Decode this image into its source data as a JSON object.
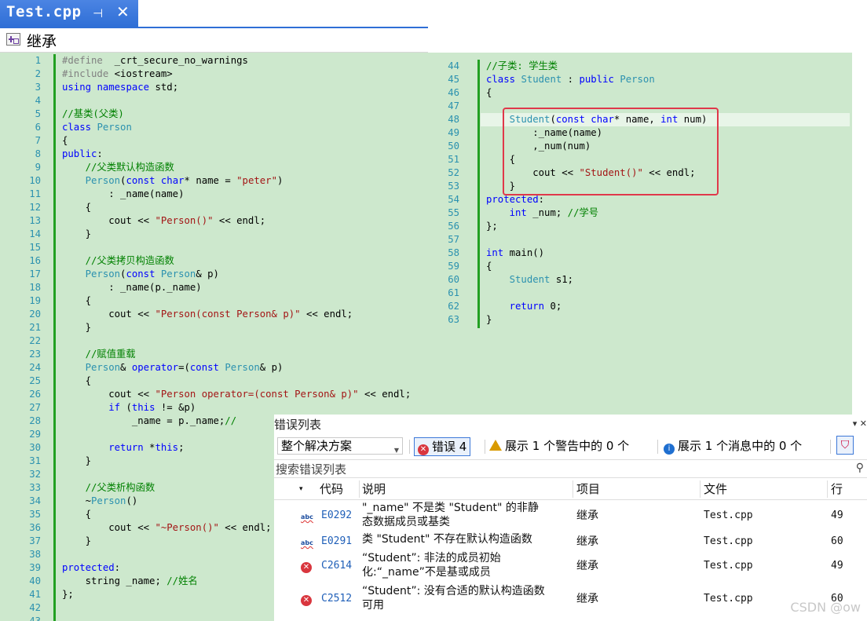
{
  "tab": {
    "title": "Test.cpp",
    "pin": "⊣",
    "close": "✕"
  },
  "nav": {
    "label": "继承"
  },
  "left_code": [
    {
      "n": "1",
      "t": "#define  _crt_secure_no_warnings"
    },
    {
      "n": "2",
      "t": "#include <iostream>"
    },
    {
      "n": "3",
      "t": "using namespace std;"
    },
    {
      "n": "4",
      "t": ""
    },
    {
      "n": "5",
      "t": "//基类(父类)"
    },
    {
      "n": "6",
      "t": "class Person"
    },
    {
      "n": "7",
      "t": "{"
    },
    {
      "n": "8",
      "t": "public:"
    },
    {
      "n": "9",
      "t": "    //父类默认构造函数"
    },
    {
      "n": "10",
      "t": "    Person(const char* name = \"peter\")"
    },
    {
      "n": "11",
      "t": "        : _name(name)"
    },
    {
      "n": "12",
      "t": "    {"
    },
    {
      "n": "13",
      "t": "        cout << \"Person()\" << endl;"
    },
    {
      "n": "14",
      "t": "    }"
    },
    {
      "n": "15",
      "t": ""
    },
    {
      "n": "16",
      "t": "    //父类拷贝构造函数"
    },
    {
      "n": "17",
      "t": "    Person(const Person& p)"
    },
    {
      "n": "18",
      "t": "        : _name(p._name)"
    },
    {
      "n": "19",
      "t": "    {"
    },
    {
      "n": "20",
      "t": "        cout << \"Person(const Person& p)\" << endl;"
    },
    {
      "n": "21",
      "t": "    }"
    },
    {
      "n": "22",
      "t": ""
    },
    {
      "n": "23",
      "t": "    //赋值重载"
    },
    {
      "n": "24",
      "t": "    Person& operator=(const Person& p)"
    },
    {
      "n": "25",
      "t": "    {"
    },
    {
      "n": "26",
      "t": "        cout << \"Person operator=(const Person& p)\" << endl;"
    },
    {
      "n": "27",
      "t": "        if (this != &p)"
    },
    {
      "n": "28",
      "t": "            _name = p._name;//"
    },
    {
      "n": "29",
      "t": ""
    },
    {
      "n": "30",
      "t": "        return *this;"
    },
    {
      "n": "31",
      "t": "    }"
    },
    {
      "n": "32",
      "t": ""
    },
    {
      "n": "33",
      "t": "    //父类析构函数"
    },
    {
      "n": "34",
      "t": "    ~Person()"
    },
    {
      "n": "35",
      "t": "    {"
    },
    {
      "n": "36",
      "t": "        cout << \"~Person()\" << endl;"
    },
    {
      "n": "37",
      "t": "    }"
    },
    {
      "n": "38",
      "t": ""
    },
    {
      "n": "39",
      "t": "protected:"
    },
    {
      "n": "40",
      "t": "    string _name; //姓名"
    },
    {
      "n": "41",
      "t": "};"
    },
    {
      "n": "42",
      "t": ""
    },
    {
      "n": "43",
      "t": ""
    }
  ],
  "right_code": [
    {
      "n": "44",
      "t": "//子类: 学生类"
    },
    {
      "n": "45",
      "t": "class Student : public Person"
    },
    {
      "n": "46",
      "t": "{"
    },
    {
      "n": "47",
      "t": ""
    },
    {
      "n": "48",
      "t": "    Student(const char* name, int num)"
    },
    {
      "n": "49",
      "t": "        :_name(name)"
    },
    {
      "n": "50",
      "t": "        ,_num(num)"
    },
    {
      "n": "51",
      "t": "    {"
    },
    {
      "n": "52",
      "t": "        cout << \"Student()\" << endl;"
    },
    {
      "n": "53",
      "t": "    }"
    },
    {
      "n": "54",
      "t": "protected:"
    },
    {
      "n": "55",
      "t": "    int _num; //学号"
    },
    {
      "n": "56",
      "t": "};"
    },
    {
      "n": "57",
      "t": ""
    },
    {
      "n": "58",
      "t": "int main()"
    },
    {
      "n": "59",
      "t": "{"
    },
    {
      "n": "60",
      "t": "    Student s1;"
    },
    {
      "n": "61",
      "t": ""
    },
    {
      "n": "62",
      "t": "    return 0;"
    },
    {
      "n": "63",
      "t": "}"
    }
  ],
  "error_list": {
    "title": "错误列表",
    "title_icons": "▾ ✕",
    "scope": "整个解决方案",
    "errors_btn": "错误 4",
    "warnings_btn": "展示 1 个警告中的 0 个",
    "messages_btn": "展示 1 个消息中的 0 个",
    "search_placeholder": "搜索错误列表",
    "headers": {
      "code": "代码",
      "desc": "说明",
      "project": "项目",
      "file": "文件",
      "line": "行"
    },
    "rows": [
      {
        "icon": "abc",
        "code": "E0292",
        "desc1": "\"_name\" 不是类 \"Student\" 的非静",
        "desc2": "态数据成员或基类",
        "project": "继承",
        "file": "Test.cpp",
        "line": "49"
      },
      {
        "icon": "abc",
        "code": "E0291",
        "desc1": "类 \"Student\" 不存在默认构造函数",
        "desc2": "",
        "project": "继承",
        "file": "Test.cpp",
        "line": "60"
      },
      {
        "icon": "x",
        "code": "C2614",
        "desc1": "“Student”: 非法的成员初始",
        "desc2": "化:“_name”不是基或成员",
        "project": "继承",
        "file": "Test.cpp",
        "line": "49"
      },
      {
        "icon": "x",
        "code": "C2512",
        "desc1": "“Student”: 没有合适的默认构造函数",
        "desc2": "可用",
        "project": "继承",
        "file": "Test.cpp",
        "line": "60"
      }
    ]
  },
  "watermark": "CSDN @ow",
  "colors": {
    "code_bg": "#cde8cd",
    "keyword": "#0000ff",
    "string": "#a31515",
    "comment": "#008000",
    "type": "#2b91af",
    "error_red": "#d9363e",
    "highlight_box": "#e0384a"
  }
}
